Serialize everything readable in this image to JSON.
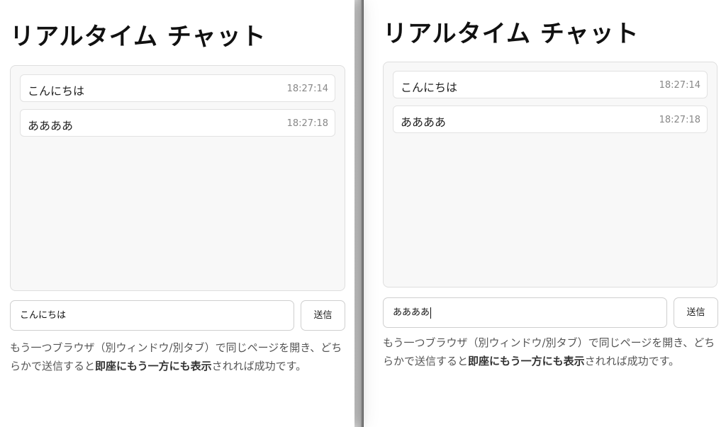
{
  "windows": [
    {
      "title": "リアルタイム チャット",
      "messages": [
        {
          "text": "こんにちは",
          "time": "18:27:14"
        },
        {
          "text": "ああああ",
          "time": "18:27:18"
        }
      ],
      "input_value": "こんにちは",
      "send_label": "送信",
      "note": {
        "part1": "もう一つブラウザ（別ウィンドウ/別タブ）で同じページを開き、どちらかで送信すると",
        "bold": "即座にもう一方にも表示",
        "part2": "されれば成功です。"
      }
    },
    {
      "title": "リアルタイム チャット",
      "messages": [
        {
          "text": "こんにちは",
          "time": "18:27:14"
        },
        {
          "text": "ああああ",
          "time": "18:27:18"
        }
      ],
      "input_value": "ああああ",
      "send_label": "送信",
      "note": {
        "part1": "もう一つブラウザ（別ウィンドウ/別タブ）で同じページを開き、どちらかで送信すると",
        "bold": "即座にもう一方にも表示",
        "part2": "されれば成功です。"
      }
    }
  ]
}
